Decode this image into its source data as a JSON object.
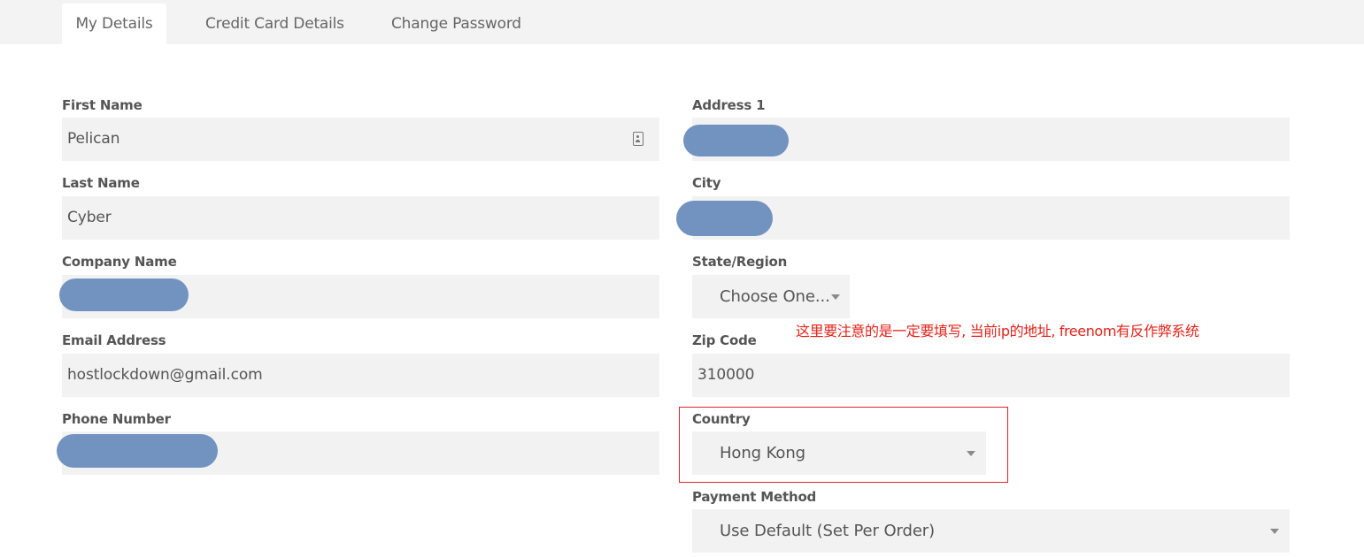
{
  "tabs": [
    {
      "label": "My Details",
      "active": true
    },
    {
      "label": "Credit Card Details",
      "active": false
    },
    {
      "label": "Change Password",
      "active": false
    }
  ],
  "left_fields": {
    "first_name": {
      "label": "First Name",
      "value": "Pelican"
    },
    "last_name": {
      "label": "Last Name",
      "value": "Cyber"
    },
    "company_name": {
      "label": "Company Name",
      "value": ""
    },
    "email": {
      "label": "Email Address",
      "value": "hostlockdown@gmail.com"
    },
    "phone": {
      "label": "Phone Number",
      "value": ""
    }
  },
  "right_fields": {
    "address1": {
      "label": "Address 1",
      "value": ""
    },
    "city": {
      "label": "City",
      "value": ""
    },
    "state": {
      "label": "State/Region",
      "selected": "Choose One..."
    },
    "zip": {
      "label": "Zip Code",
      "value": "310000"
    },
    "country": {
      "label": "Country",
      "selected": "Hong Kong"
    },
    "payment_method": {
      "label": "Payment Method",
      "selected": "Use Default (Set Per Order)"
    }
  },
  "annotation": {
    "text": "这里要注意的是一定要填写, 当前ip的地址, freenom有反作弊系统",
    "color": "#e2231a"
  },
  "colors": {
    "field_bg": "#f2f2f2",
    "tabbar_bg": "#f3f3f3",
    "redaction": "#7293c0"
  },
  "icons": {
    "first_name_field": "contact-card-icon"
  }
}
